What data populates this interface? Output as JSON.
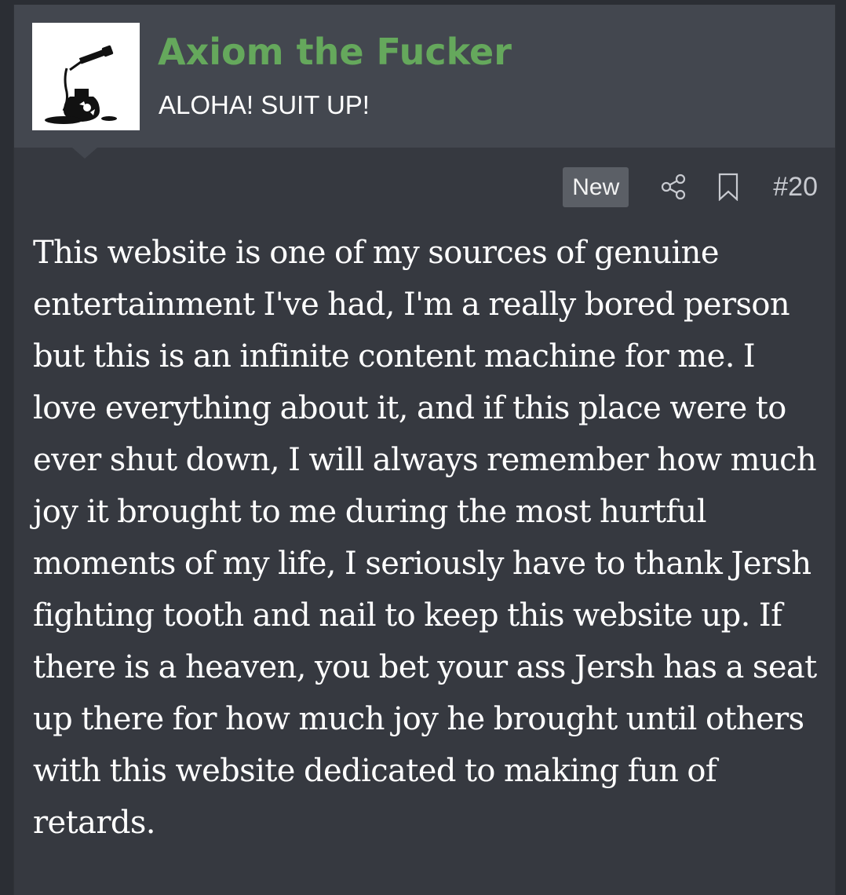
{
  "user": {
    "name": "Axiom the Fucker",
    "title": "ALOHA! SUIT UP!",
    "name_color": "#65a85c",
    "avatar_icon": "ink-bottle-dropper-icon"
  },
  "attribution": {
    "badge": "New",
    "share_icon": "share-icon",
    "bookmark_icon": "bookmark-icon",
    "post_number": "#20"
  },
  "post": {
    "body": "This website is one of my sources of genuine entertainment I've had, I'm a really bored person but this is an infinite content machine for me. I love everything about it, and if this place were to ever shut down, I will always remember how much joy it brought to me during the most hurtful moments of my life, I seriously have to thank Jersh fighting tooth and nail to keep this website up. If there is a heaven, you bet your ass Jersh has a seat up there for how much joy he brought until others with this website dedicated to making fun of retards."
  }
}
